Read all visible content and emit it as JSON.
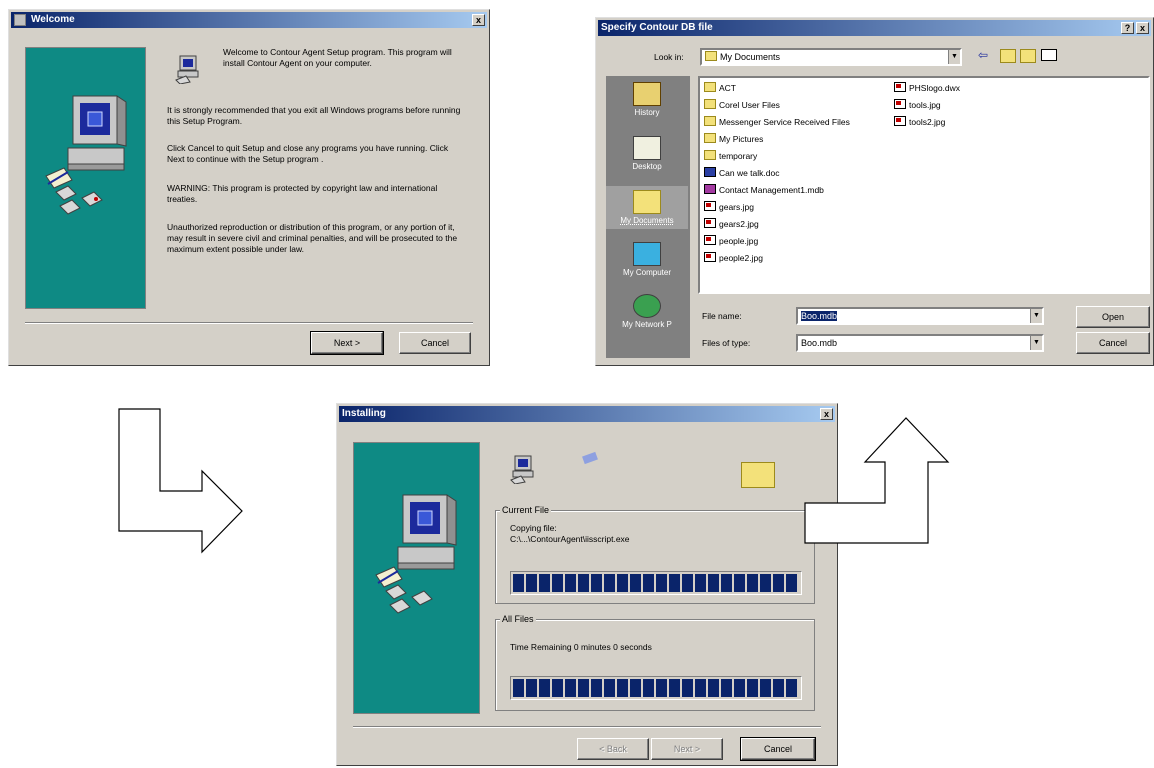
{
  "welcome": {
    "title": "Welcome",
    "close": "x",
    "para1": "Welcome to Contour Agent Setup program. This program will install Contour Agent on your computer.",
    "para2": "It is strongly recommended that you exit all Windows programs before running this Setup Program.",
    "para3": "Click Cancel to quit Setup and close any programs you have running.  Click Next to continue with the Setup program .",
    "para4": "WARNING: This program is protected by copyright law and international treaties.",
    "para5": "Unauthorized reproduction or distribution of this program, or any portion of it, may result in severe civil and criminal penalties, and will be prosecuted to the maximum extent possible under law.",
    "next_label": "Next >",
    "cancel_label": "Cancel"
  },
  "open_dialog": {
    "title": "Specify Contour DB file",
    "help": "?",
    "close": "x",
    "look_in_label": "Look in:",
    "look_in_value": "My Documents",
    "places": [
      "History",
      "Desktop",
      "My Documents",
      "My Computer",
      "My Network P"
    ],
    "files_col1": [
      {
        "name": "ACT",
        "type": "folder"
      },
      {
        "name": "Corel User Files",
        "type": "folder"
      },
      {
        "name": "Messenger Service Received Files",
        "type": "folder"
      },
      {
        "name": "My Pictures",
        "type": "folder"
      },
      {
        "name": "temporary",
        "type": "folder"
      },
      {
        "name": "Can we talk.doc",
        "type": "doc"
      },
      {
        "name": "Contact Management1.mdb",
        "type": "mdb"
      },
      {
        "name": "gears.jpg",
        "type": "img"
      },
      {
        "name": "gears2.jpg",
        "type": "img"
      },
      {
        "name": "people.jpg",
        "type": "img"
      },
      {
        "name": "people2.jpg",
        "type": "img"
      }
    ],
    "files_col2": [
      {
        "name": "PHSlogo.dwx",
        "type": "img"
      },
      {
        "name": "tools.jpg",
        "type": "img"
      },
      {
        "name": "tools2.jpg",
        "type": "img"
      }
    ],
    "file_name_label": "File name:",
    "file_name_value": "Boo.mdb",
    "files_of_type_label": "Files of type:",
    "files_of_type_value": "Boo.mdb",
    "open_label": "Open",
    "cancel_label": "Cancel"
  },
  "installing": {
    "title": "Installing",
    "close": "x",
    "current_file_label": "Current File",
    "copying_label": "Copying file:",
    "copying_path": "C:\\...\\ContourAgent\\iisscript.exe",
    "current_progress": 1.0,
    "all_files_label": "All Files",
    "time_remaining": "Time Remaining 0 minutes 0 seconds",
    "all_progress": 1.0,
    "back_label": "< Back",
    "next_label": "Next >",
    "cancel_label": "Cancel"
  }
}
